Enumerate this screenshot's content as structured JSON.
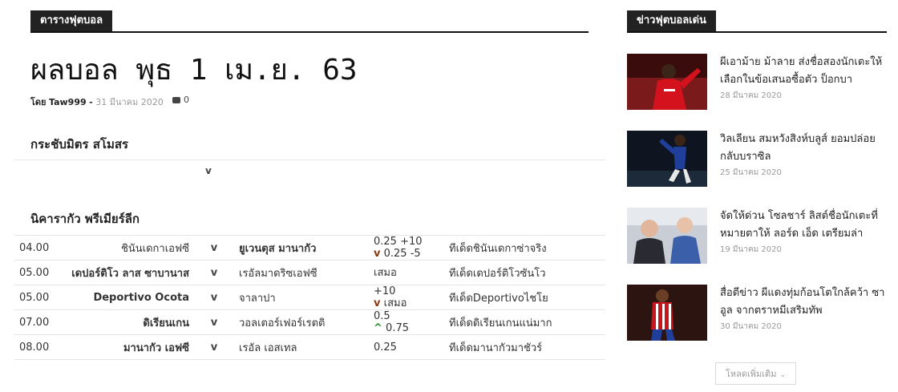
{
  "main": {
    "block_title": "ตารางฟุตบอล",
    "post_title": "ผลบอล พุธ 1 เม.ย. 63",
    "meta": {
      "by": "โดย",
      "author": "Taw999",
      "separator": "-",
      "date": "31 มีนาคม 2020",
      "comments": "0"
    },
    "friendly_section": {
      "title": "กระชับมิตร สโมสร",
      "vs": "v"
    },
    "league_section": {
      "title": "นิคารากัว พรีเมียร์ลีก",
      "rows": [
        {
          "time": "04.00",
          "home": "ชินันเดกาเอฟซี",
          "vs": "v",
          "away": "ยูเวนตุส มานากัว",
          "odds1": "0.25 +10",
          "mark": "v",
          "odds2": "0.25 -5",
          "tip": "ทีเด็ดชินันเดกาซ่าจริง"
        },
        {
          "time": "05.00",
          "home": "เดปอร์ติโว ลาส ซาบานาส",
          "vs": "v",
          "away": "เรอัลมาดริซเอฟซี",
          "odds1": "เสมอ",
          "mark": "",
          "odds2": "",
          "tip": "ทีเด็ดเดปอร์ติโวซันโว"
        },
        {
          "time": "05.00",
          "home": "Deportivo Ocota",
          "vs": "v",
          "away": "จาลาปา",
          "odds1": "+10",
          "mark": "v",
          "odds2": "เสมอ",
          "tip": "ทีเด็ดDeportivoไชโย"
        },
        {
          "time": "07.00",
          "home": "ดิเรียนเกน",
          "vs": "v",
          "away": "วอลเตอร์เฟอร์เรตติ",
          "odds1": "0.5",
          "mark": "^",
          "odds2": "0.75",
          "tip": "ทีเด็ดดิเรียนเกนแน่มาก"
        },
        {
          "time": "08.00",
          "home": "มานากัว เอฟซี",
          "vs": "v",
          "away": "เรอัล เอสเทล",
          "odds1": "0.25",
          "mark": "",
          "odds2": "",
          "tip": "ทีเด็ดมานากัวมาชัวร์"
        }
      ]
    }
  },
  "sidebar": {
    "block_title": "ข่าวฟุตบอลเด่น",
    "news": [
      {
        "title": "ผีเอาม้าย ม้าลาย ส่งชื่อสองนักเตะให้เลือกในข้อเสนอซื้อตัว ป็อกบา",
        "date": "28 มีนาคม 2020"
      },
      {
        "title": "วิลเลียน สมหวังสิงห์บลูส์ ยอมปล่อยกลับบราซิล",
        "date": "25 มีนาคม 2020"
      },
      {
        "title": "จัดให้ด่วน โซลชาร์ ลิสต์ชื่อนักเตะที่หมายตาให้ ลอร์ด เอ็ด เตรียมล่า",
        "date": "19 มีนาคม 2020"
      },
      {
        "title": "สื่อตีข่าว ผีแดงทุ่มก้อนโตใกล้คว้า ซาอูล จากตราหมีเสริมทัพ",
        "date": "30 มีนาคม 2020"
      }
    ],
    "load_more": "โหลดเพิ่มเติม"
  },
  "colors": {
    "accent_dark": "#222222",
    "favorite_team": "#8b3a0f",
    "up_arrow": "#2e8b2e",
    "muted": "#999999"
  }
}
